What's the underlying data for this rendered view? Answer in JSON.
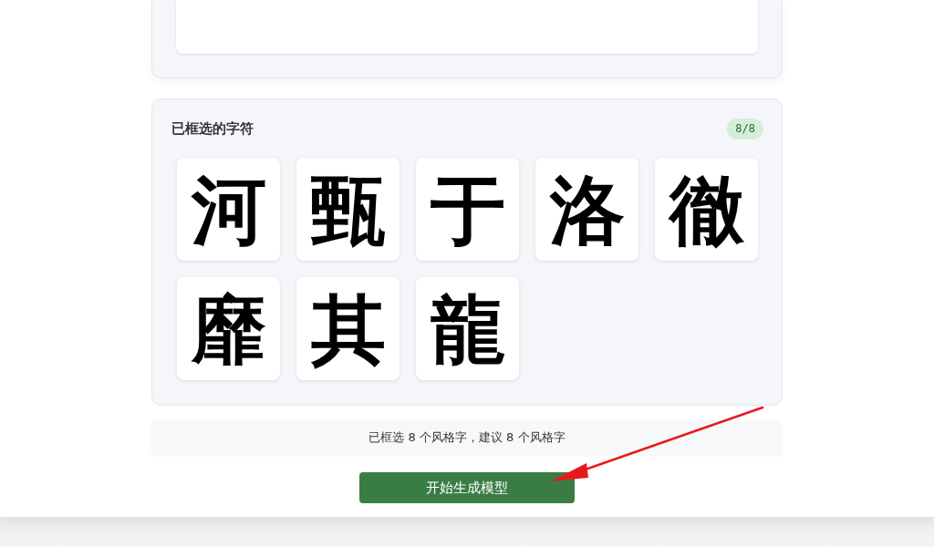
{
  "selected_characters": {
    "title": "已框选的字符",
    "badge": "8/8",
    "glyphs": [
      "河",
      "甄",
      "于",
      "洛",
      "徹",
      "靡",
      "其",
      "龍"
    ]
  },
  "status_bar": "已框选 8 个风格字，建议 8 个风格字",
  "primary_button": "开始生成模型"
}
